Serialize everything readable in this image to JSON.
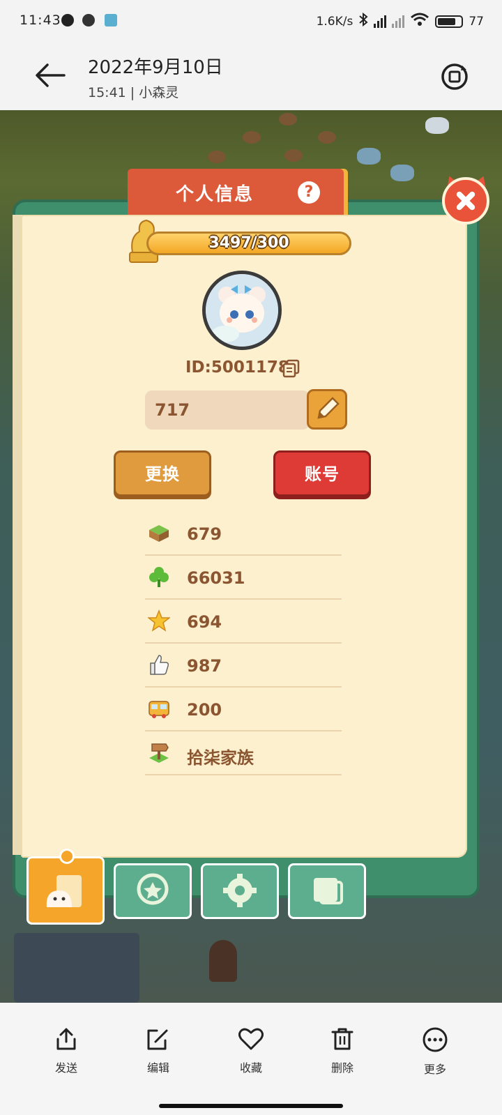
{
  "status_bar": {
    "time": "11:43",
    "net_speed": "1.6K/s",
    "battery": "77",
    "battery_fraction": 0.77
  },
  "header": {
    "date": "2022年9月10日",
    "subtitle": "15:41 | 小森灵"
  },
  "game": {
    "panel_title": "个人信息",
    "help_symbol": "?",
    "progress_text": "3497/300",
    "progress_fraction": 1.0,
    "user_id": "ID:5001178",
    "name_value": "717",
    "change_button": "更换",
    "account_button": "账号",
    "stats": [
      {
        "icon": "grass-block-icon",
        "value": "679"
      },
      {
        "icon": "clover-icon",
        "value": "66031"
      },
      {
        "icon": "star-icon",
        "value": "694"
      },
      {
        "icon": "thumbs-up-icon",
        "value": "987"
      },
      {
        "icon": "bus-icon",
        "value": "200"
      },
      {
        "icon": "signpost-icon",
        "value": "拾柒家族"
      }
    ],
    "tabs": [
      "profile-tab-icon",
      "badge-tab-icon",
      "gear-tab-icon",
      "album-tab-icon"
    ]
  },
  "toolbar": {
    "send": "发送",
    "edit": "编辑",
    "favorite": "收藏",
    "delete": "删除",
    "more": "更多"
  },
  "colors": {
    "panel_header": "#dc5a3a",
    "paper": "#fcf0ce",
    "book_green": "#3f8e6c",
    "text_brown": "#8a5530",
    "progress_fill": "#f4a726",
    "change_button": "#e09b3e",
    "account_button": "#de3b36"
  }
}
